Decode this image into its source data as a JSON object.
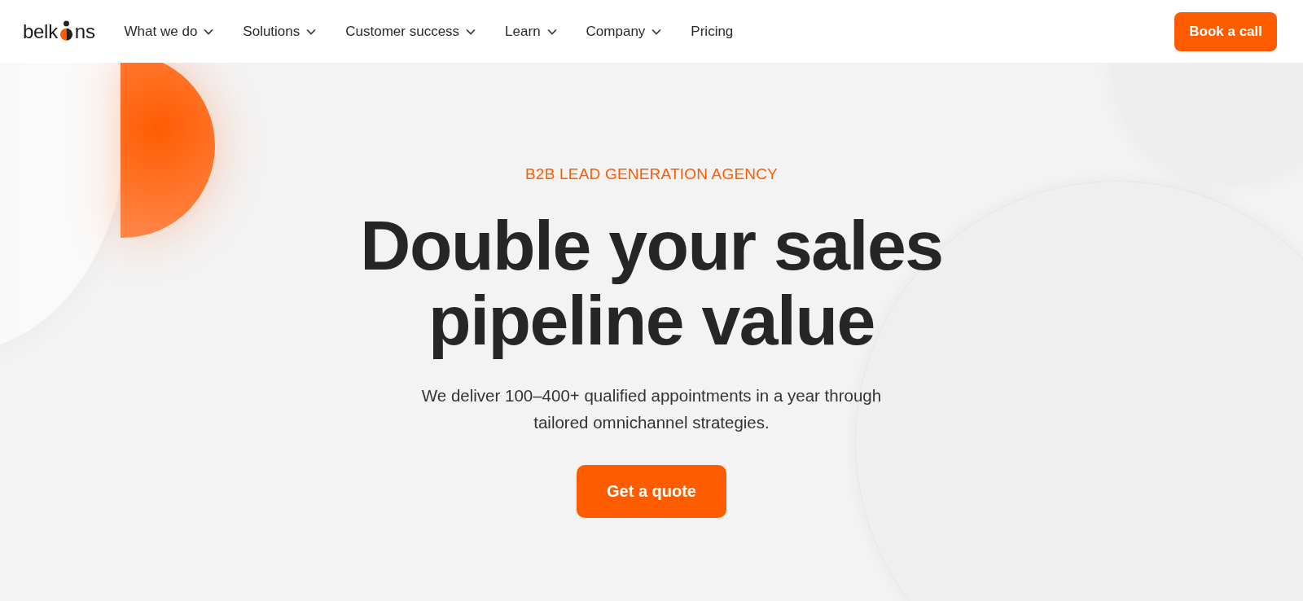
{
  "header": {
    "logo": {
      "before": "belk",
      "after": "ns"
    },
    "nav": [
      {
        "label": "What we do",
        "dropdown": true
      },
      {
        "label": "Solutions",
        "dropdown": true
      },
      {
        "label": "Customer success",
        "dropdown": true
      },
      {
        "label": "Learn",
        "dropdown": true
      },
      {
        "label": "Company",
        "dropdown": true
      },
      {
        "label": "Pricing",
        "dropdown": false
      }
    ],
    "cta": "Book a call"
  },
  "hero": {
    "eyebrow": "B2B LEAD GENERATION AGENCY",
    "headline": [
      "Double your sales",
      "pipeline value"
    ],
    "description": "We deliver 100–400+ qualified appointments in a year through tailored omnichannel strategies.",
    "button": "Get a quote"
  }
}
